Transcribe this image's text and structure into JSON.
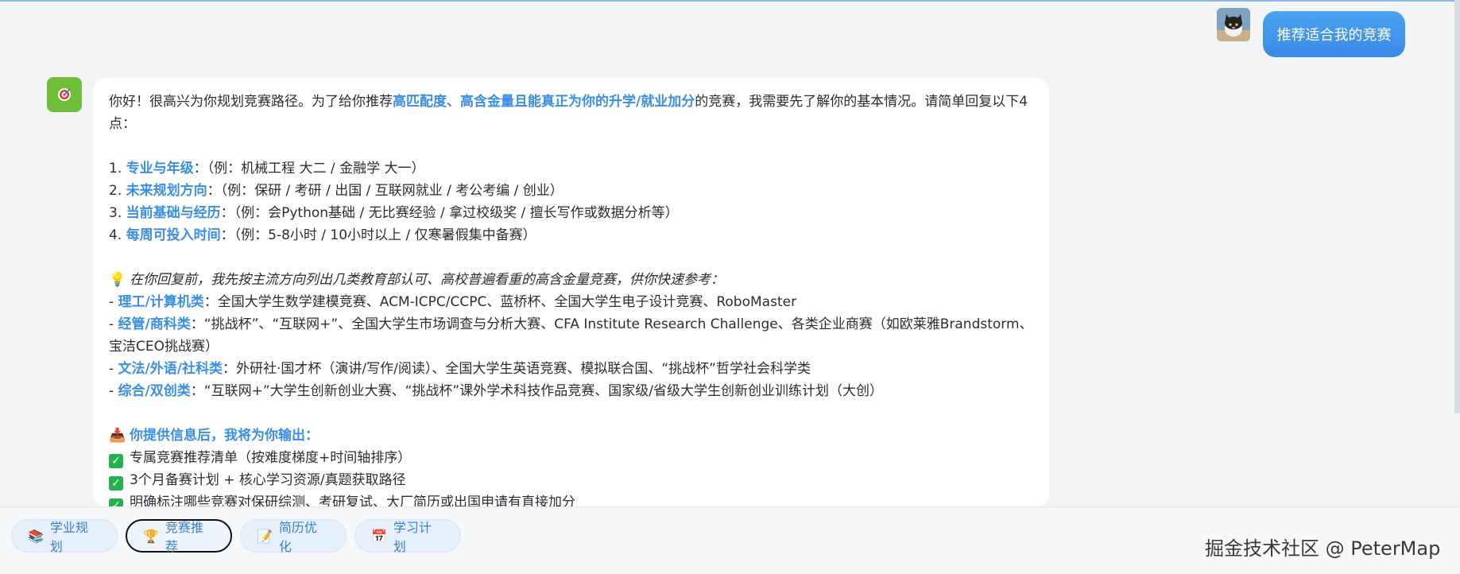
{
  "user": {
    "message": "推荐适合我的竞赛",
    "avatar_icon": "cat-avatar-icon"
  },
  "bot": {
    "avatar_icon": "target-icon",
    "intro_a": "你好！很高兴为你规划竞赛路径。为了给你推荐",
    "intro_hl": "高匹配度、高含金量且能真正为你的升学/就业加分",
    "intro_b": "的竞赛，我需要先了解你的基本情况。请简单回复以下4点：",
    "questions": [
      {
        "num": "1. ",
        "label": "专业与年级",
        "text": "：（例：机械工程 大二 / 金融学 大一）"
      },
      {
        "num": "2. ",
        "label": "未来规划方向",
        "text": "：（例：保研 / 考研 / 出国 / 互联网就业 / 考公考编 / 创业）"
      },
      {
        "num": "3. ",
        "label": "当前基础与经历",
        "text": "：（例：会Python基础 / 无比赛经验 / 拿过校级奖 / 擅长写作或数据分析等）"
      },
      {
        "num": "4. ",
        "label": "每周可投入时间",
        "text": "：（例：5-8小时 / 10小时以上 / 仅寒暑假集中备赛）"
      }
    ],
    "tip_icon": "💡",
    "tip": "在你回复前，我先按主流方向列出几类教育部认可、高校普遍看重的高含金量竞赛，供你快速参考：",
    "categories": [
      {
        "label": "理工/计算机类",
        "text": "：全国大学生数学建模竞赛、ACM-ICPC/CCPC、蓝桥杯、全国大学生电子设计竞赛、RoboMaster"
      },
      {
        "label": "经管/商科类",
        "text": "：“挑战杯”、“互联网+”、全国大学生市场调查与分析大赛、CFA Institute Research Challenge、各类企业商赛（如欧莱雅Brandstorm、宝洁CEO挑战赛）"
      },
      {
        "label": "文法/外语/社科类",
        "text": "：外研社·国才杯（演讲/写作/阅读）、全国大学生英语竞赛、模拟联合国、“挑战杯”哲学社会科学类"
      },
      {
        "label": "综合/双创类",
        "text": "：“互联网+”大学生创新创业大赛、“挑战杯”课外学术科技作品竞赛、国家级/省级大学生创新创业训练计划（大创）"
      }
    ],
    "output_icon": "📥",
    "output_heading": "你提供信息后，我将为你输出：",
    "outputs": [
      "专属竞赛推荐清单（按难度梯度+时间轴排序）",
      "3个月备赛计划 + 核心学习资源/真题获取路径",
      "明确标注哪些竞赛对保研综测、考研复试、大厂简历或出国申请有直接加分"
    ]
  },
  "quick_actions": [
    {
      "icon": "📚",
      "label": "学业规划",
      "active": false
    },
    {
      "icon": "🏆",
      "label": "竞赛推荐",
      "active": true
    },
    {
      "icon": "📝",
      "label": "简历优化",
      "active": false
    },
    {
      "icon": "📅",
      "label": "学习计划",
      "active": false
    }
  ],
  "watermark": "掘金技术社区 @ PeterMap"
}
